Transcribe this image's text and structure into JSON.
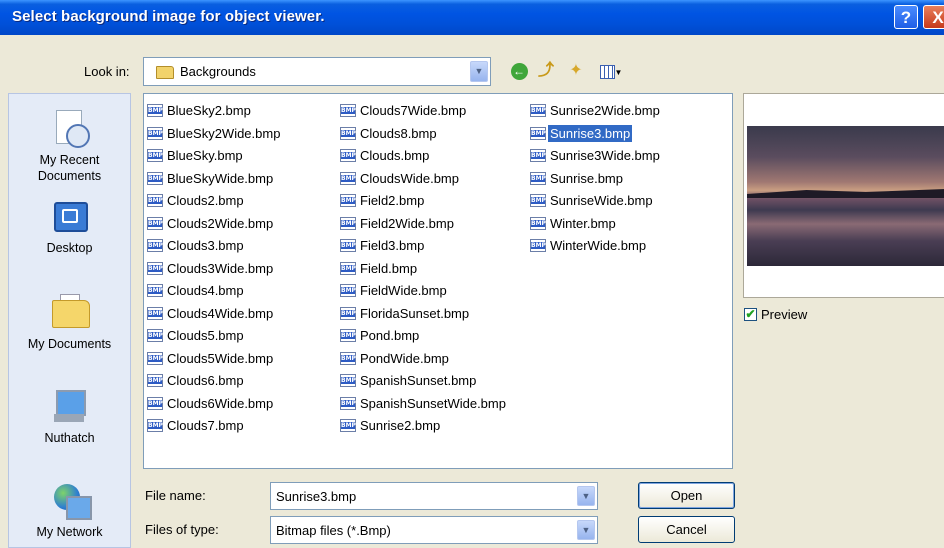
{
  "window": {
    "title": "Select background image for object viewer.",
    "help_glyph": "?",
    "close_glyph": "X"
  },
  "look_in": {
    "label": "Look in:",
    "value": "Backgrounds"
  },
  "places": [
    {
      "label": "My Recent Documents",
      "icon": "recent-documents-icon"
    },
    {
      "label": "Desktop",
      "icon": "desktop-icon"
    },
    {
      "label": "My Documents",
      "icon": "my-documents-icon"
    },
    {
      "label": "Nuthatch",
      "icon": "computer-icon"
    },
    {
      "label": "My Network",
      "icon": "network-icon"
    }
  ],
  "files": {
    "col1": [
      "BlueSky2.bmp",
      "BlueSky2Wide.bmp",
      "BlueSky.bmp",
      "BlueSkyWide.bmp",
      "Clouds2.bmp",
      "Clouds2Wide.bmp",
      "Clouds3.bmp",
      "Clouds3Wide.bmp",
      "Clouds4.bmp",
      "Clouds4Wide.bmp",
      "Clouds5.bmp",
      "Clouds5Wide.bmp",
      "Clouds6.bmp",
      "Clouds6Wide.bmp",
      "Clouds7.bmp"
    ],
    "col2": [
      "Clouds7Wide.bmp",
      "Clouds8.bmp",
      "Clouds.bmp",
      "CloudsWide.bmp",
      "Field2.bmp",
      "Field2Wide.bmp",
      "Field3.bmp",
      "Field.bmp",
      "FieldWide.bmp",
      "FloridaSunset.bmp",
      "Pond.bmp",
      "PondWide.bmp",
      "SpanishSunset.bmp",
      "SpanishSunsetWide.bmp",
      "Sunrise2.bmp"
    ],
    "col3": [
      "Sunrise2Wide.bmp",
      "Sunrise3.bmp",
      "Sunrise3Wide.bmp",
      "Sunrise.bmp",
      "SunriseWide.bmp",
      "Winter.bmp",
      "WinterWide.bmp"
    ],
    "selected": "Sunrise3.bmp"
  },
  "preview": {
    "label": "Preview",
    "checked": true
  },
  "file_name": {
    "label": "File name:",
    "value": "Sunrise3.bmp"
  },
  "file_type": {
    "label": "Files of type:",
    "value": "Bitmap files (*.Bmp)"
  },
  "buttons": {
    "open": "Open",
    "cancel": "Cancel"
  },
  "colors": {
    "titlebar": "#0054e3",
    "selection": "#316ac5",
    "dialog_bg": "#ece9d8"
  }
}
